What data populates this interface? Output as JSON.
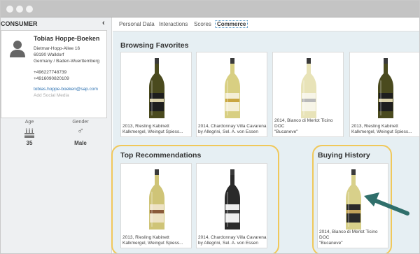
{
  "colors": {
    "highlight": "#f0c85a",
    "arrow": "#2f6f6b",
    "link": "#2a6fb0",
    "main_bg": "#e6eff3"
  },
  "left": {
    "header": "CONSUMER",
    "collapse_icon": "‹",
    "contact": {
      "name": "Tobias Hoppe-Boeken",
      "street": "Dietmar-Hopp-Allee 16",
      "city": "69190 Walldorf",
      "region": "Germany / Baden-Wuerttemberg",
      "phone": "+496227748739",
      "mobile": "+4916090820109",
      "email": "tobias.hoppe-boeken@sap.com",
      "add_social": "Add Social Media"
    },
    "attributes": [
      {
        "label": "Age",
        "value": "35",
        "icon": "cake-icon"
      },
      {
        "label": "Gender",
        "value": "Male",
        "icon": "male-gender-icon"
      }
    ]
  },
  "tabs": [
    "Personal Data",
    "Interactions",
    "Scores",
    "Commerce"
  ],
  "active_tab": "Commerce",
  "sections": {
    "browsing": {
      "title": "Browsing Favorites",
      "items": [
        {
          "line1": "2013, Riesling Kabinett",
          "line2": "Kalkmergel, Weingut Spiess..."
        },
        {
          "line1": "2014, Chardonnay Villa Cavarena",
          "line2": "by Allegrini, Sel. A. von Essen"
        },
        {
          "line1": "2014, Bianco di Merlot Ticino DOC",
          "line2": "\"Bucaneve\""
        },
        {
          "line1": "2013, Riesling Kabinett",
          "line2": "Kalkmergel, Weingut Spiess..."
        }
      ]
    },
    "recommendations": {
      "title": "Top Recommendations",
      "items": [
        {
          "line1": "2013, Riesling Kabinett",
          "line2": "Kalkmergel, Weingut Spiess..."
        },
        {
          "line1": "2014, Chardonnay Villa Cavarena",
          "line2": "by Allegrini, Sel. A. von Essen"
        }
      ]
    },
    "history": {
      "title": "Buying History",
      "items": [
        {
          "line1": "2014, Bianco di Merlot Ticino DOC",
          "line2": "\"Bucaneve\""
        }
      ]
    }
  }
}
